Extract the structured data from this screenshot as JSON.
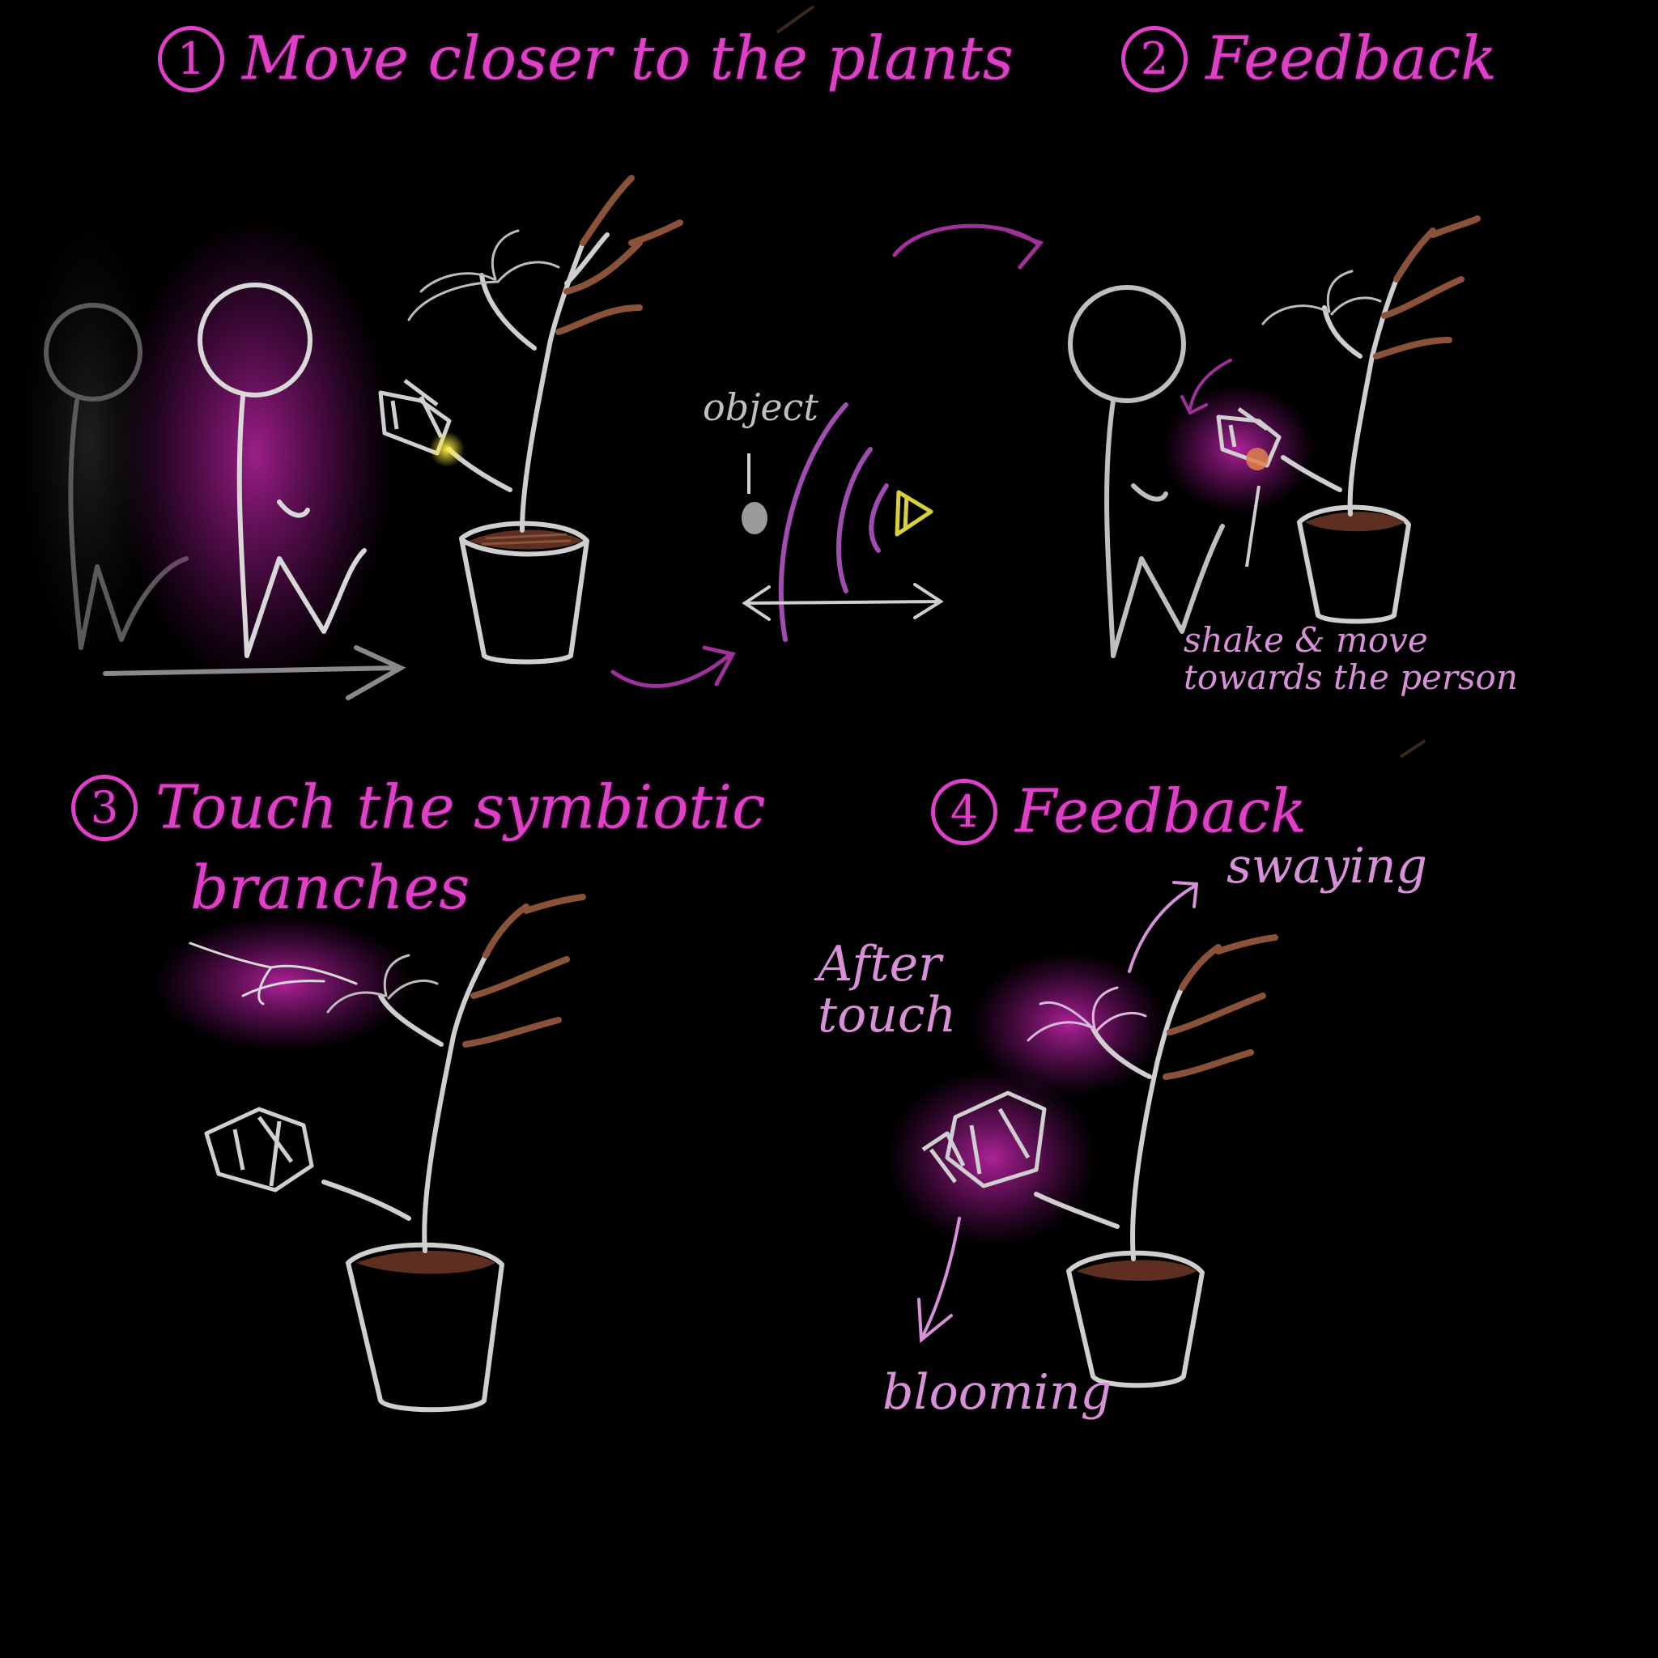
{
  "colors": {
    "heading": "#e040c8",
    "note": "#d890d8",
    "grey": "#bfbfbf",
    "plant": "#cfcfcf",
    "branch": "#8a5238",
    "soil": "#5e2f20",
    "glow": "#c026a8",
    "sensor": "#d8d040",
    "arrow": "#a0309a"
  },
  "steps": [
    {
      "number": "1",
      "label": "Move closer to the plants"
    },
    {
      "number": "2",
      "label": "Feedback"
    },
    {
      "number": "3",
      "label": "Touch the symbiotic",
      "label_line2": "branches"
    },
    {
      "number": "4",
      "label": "Feedback"
    }
  ],
  "annotations": {
    "object": "object",
    "shake_move_line1": "shake & move",
    "shake_move_line2": "towards the person",
    "after_touch_line1": "After",
    "after_touch_line2": "touch",
    "swaying": "swaying",
    "blooming": "blooming"
  },
  "icons": {
    "person": "stick-figure-icon",
    "plant": "potted-plant-icon",
    "hand": "pointing-hand-icon",
    "sensor": "proximity-sensor-icon"
  }
}
